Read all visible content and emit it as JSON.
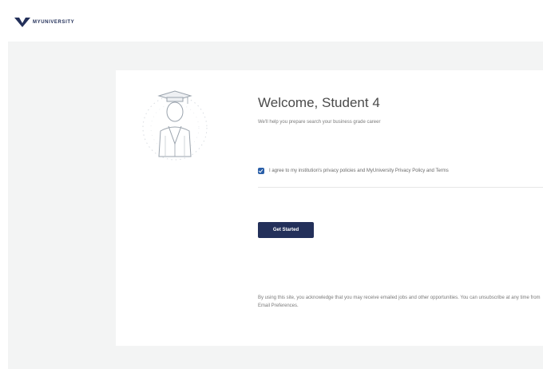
{
  "header": {
    "brand_name": "MYUNIVERSITY",
    "logo_icon": "v-shield-logo-icon"
  },
  "welcome": {
    "title": "Welcome, Student 4",
    "subtitle": "We'll help you prepare search your business grade career",
    "avatar_icon": "graduate-avatar-icon"
  },
  "consent": {
    "checked": true,
    "text": "I agree to my institution's privacy policies and MyUniversity Privacy Policy and Terms"
  },
  "actions": {
    "get_started_label": "Get Started"
  },
  "footer": {
    "text": "By using this site, you acknowledge that you may receive emailed jobs and other opportunities. You can unsubscribe at any time from Email Preferences."
  },
  "colors": {
    "brand_navy": "#23305a",
    "checkbox_blue": "#2a5fa8",
    "page_background": "#f3f4f4"
  }
}
